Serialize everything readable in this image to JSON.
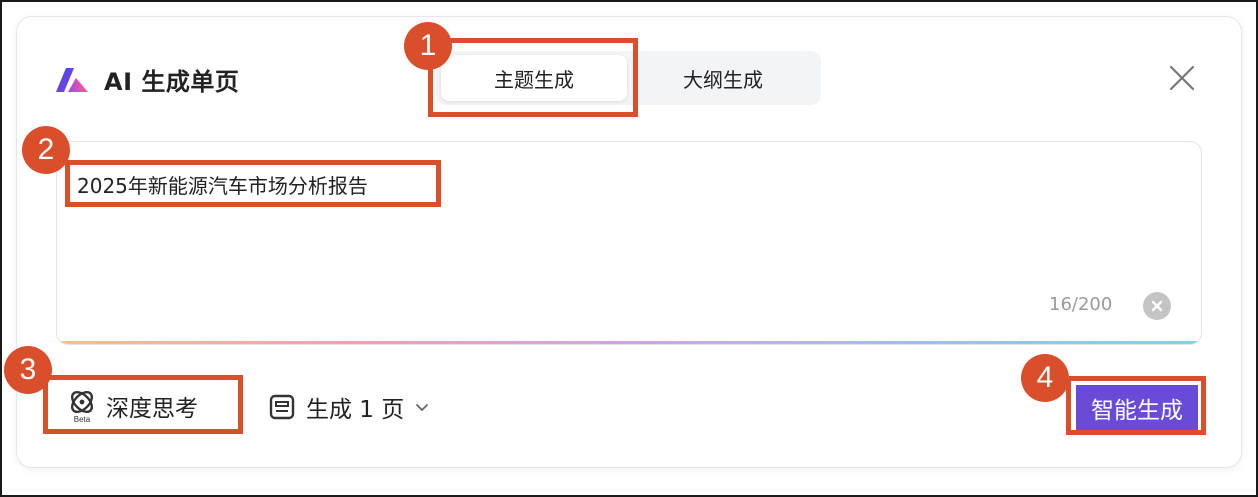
{
  "header": {
    "title": "AI 生成单页",
    "logo_icon": "brand-logo-icon",
    "close_icon": "close-icon"
  },
  "tabs": [
    {
      "label": "主题生成",
      "active": true
    },
    {
      "label": "大纲生成",
      "active": false
    }
  ],
  "input": {
    "value": "2025年新能源汽车市场分析报告",
    "counter": "16/200",
    "clear_icon": "clear-icon"
  },
  "toolbar": {
    "deep_think_label": "深度思考",
    "deep_think_badge": "Beta",
    "page_count_label": "生成 1 页",
    "generate_label": "智能生成"
  },
  "annotations": [
    "1",
    "2",
    "3",
    "4"
  ],
  "colors": {
    "annotation": "#d94f2b",
    "generate_button": "#6a4bd8"
  }
}
